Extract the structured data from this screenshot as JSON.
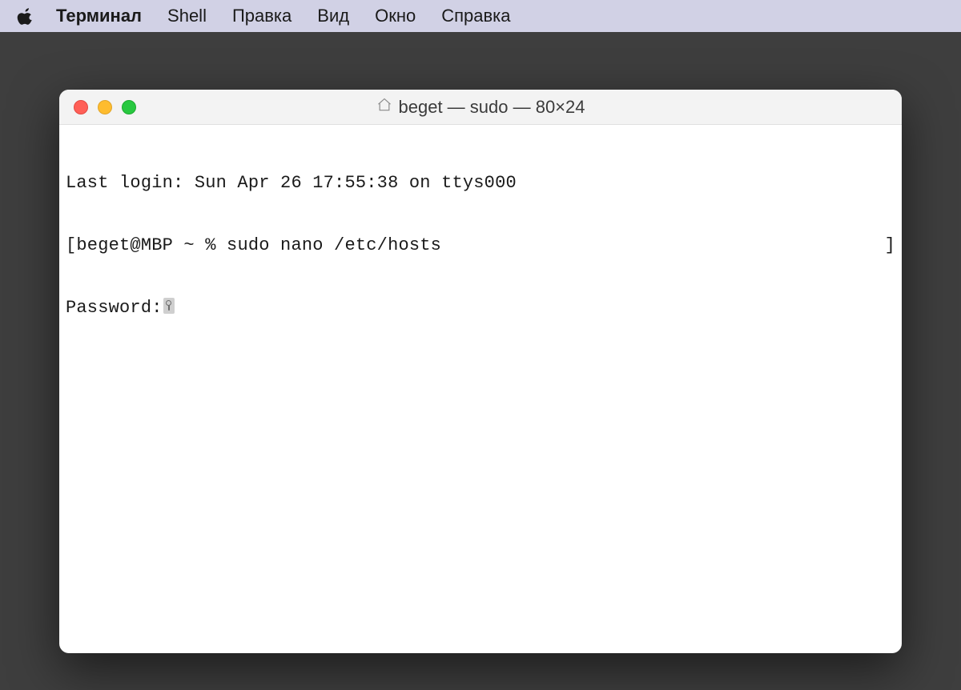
{
  "menubar": {
    "app": "Терминал",
    "items": [
      "Shell",
      "Правка",
      "Вид",
      "Окно",
      "Справка"
    ]
  },
  "window": {
    "title": "beget — sudo — 80×24"
  },
  "terminal": {
    "last_login": "Last login: Sun Apr 26 17:55:38 on ttys000",
    "left_bracket": "[",
    "prompt_and_cmd": "beget@MBP ~ % sudo nano /etc/hosts",
    "right_bracket": "]",
    "password_label": "Password:"
  }
}
